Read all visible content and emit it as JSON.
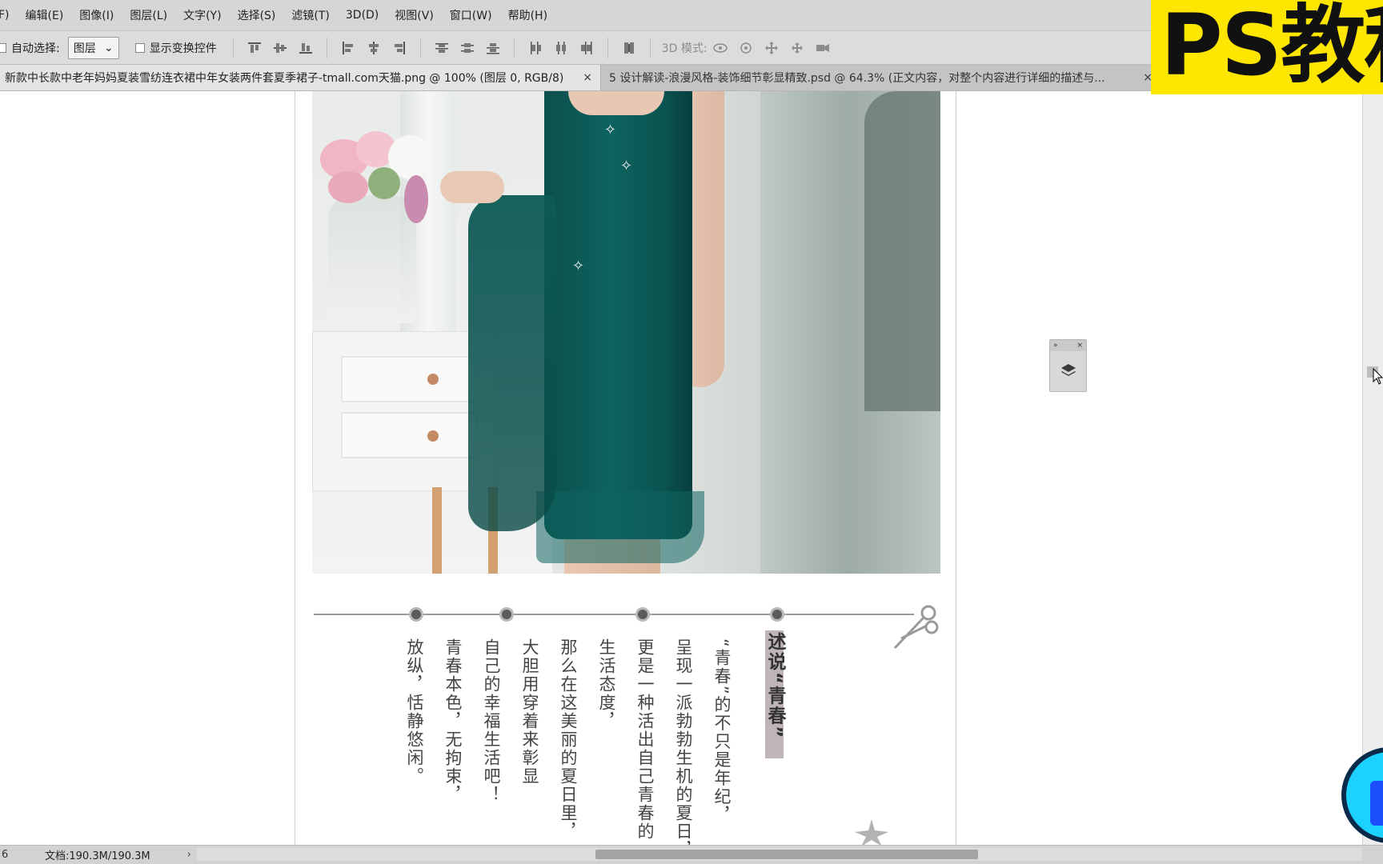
{
  "menubar": {
    "items": [
      "F)",
      "编辑(E)",
      "图像(I)",
      "图层(L)",
      "文字(Y)",
      "选择(S)",
      "滤镜(T)",
      "3D(D)",
      "视图(V)",
      "窗口(W)",
      "帮助(H)"
    ]
  },
  "options": {
    "auto_select_label": "自动选择:",
    "auto_select_value": "图层",
    "show_transform_label": "显示变换控件",
    "mode_3d_label": "3D 模式:"
  },
  "tabs": [
    {
      "title": "新款中长款中老年妈妈夏装雪纺连衣裙中年女装两件套夏季裙子-tmall.com天猫.png @ 100% (图层 0, RGB/8)",
      "close": "×"
    },
    {
      "title": "5 设计解读-浪漫风格-装饰细节彰显精致.psd @ 64.3% (正文内容，对整个内容进行详细的描述与...",
      "close": "×"
    }
  ],
  "canvas": {
    "title": "述说“青春”",
    "columns": [
      "“青春”的不只是年纪，",
      "呈现一派勃勃生机的夏日，",
      "更是一种活出自己青春的",
      "生活态度，",
      "那么在这美丽的夏日里，",
      "大胆用穿着来彰显",
      "自己的幸福生活吧！",
      "青春本色，无拘束，",
      "放纵，恬静悠闲。"
    ]
  },
  "float_panel": {
    "expand": "»",
    "close": "×"
  },
  "status": {
    "zoom": "6",
    "doc": "文档:190.3M/190.3M",
    "arrow": "›"
  },
  "overlay": {
    "banner": "PS教程"
  },
  "colors": {
    "dress": "#0e6360",
    "banner": "#ffe600",
    "title_bar": "#bfb5b7",
    "timeline_dot": "#5c5c5c"
  }
}
